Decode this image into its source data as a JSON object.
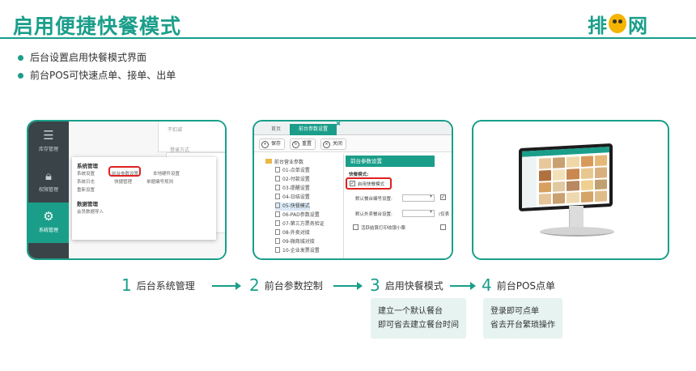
{
  "header": {
    "title": "启用便捷快餐模式",
    "logo_text_left": "排",
    "logo_text_right": "网"
  },
  "bullets": [
    "后台设置启用快餐模式界面",
    "前台POS可快速点单、接单、出单"
  ],
  "panel1": {
    "sidebar": [
      {
        "label": "库存管理",
        "icon": "box-icon"
      },
      {
        "label": "权限管理",
        "icon": "lock-icon"
      },
      {
        "label": "系统管理",
        "icon": "gear-icon"
      }
    ],
    "bg_texts": [
      "不扣减",
      "登录方式"
    ],
    "section1_title": "系统管理",
    "section1_items": [
      "系统设置",
      "前台参数设置",
      "本地硬件设置",
      "系统日志",
      "快捷管理",
      "单据编号规则",
      "重新设置"
    ],
    "section2_title": "数据管理",
    "section2_items": [
      "会员数据导入"
    ],
    "highlighted_item": "前台参数设置"
  },
  "panel2": {
    "tabs": [
      "首页",
      "前台参数设置"
    ],
    "toolbar": [
      "保存",
      "重置",
      "关闭"
    ],
    "tree_root": "前台营业参数",
    "tree_items": [
      "01-点单设置",
      "02-付款设置",
      "03-提醒设置",
      "04-日结设置",
      "05-快餐模式",
      "06-PAD参数设置",
      "07-第三方票务验证",
      "08-外卖对接",
      "09-微商城对接",
      "10-企业发票设置"
    ],
    "selected_item": "05-快餐模式",
    "form_header": "前台参数设置",
    "form_section": "快餐模式:",
    "enable_label": "启用快餐模式",
    "field1_label": "默认餐台编号设置:",
    "field2_label": "默认外卖餐台设置:",
    "field2_suffix": "(仅表",
    "option_label": "活跃结算打印收银小票"
  },
  "panel3": {
    "device": "pos-terminal-image"
  },
  "steps": [
    {
      "num": "1",
      "label": "后台系统管理"
    },
    {
      "num": "2",
      "label": "前台参数控制"
    },
    {
      "num": "3",
      "label": "启用快餐模式"
    },
    {
      "num": "4",
      "label": "前台POS点单"
    }
  ],
  "notes": [
    {
      "line1": "建立一个默认餐台",
      "line2": "即可省去建立餐台时间"
    },
    {
      "line1": "登录即可点单",
      "line2": "省去开台繁琐操作"
    }
  ],
  "colors": {
    "accent": "#1a9e8a",
    "highlight": "#e02020",
    "note_bg": "#e6f3f1"
  }
}
